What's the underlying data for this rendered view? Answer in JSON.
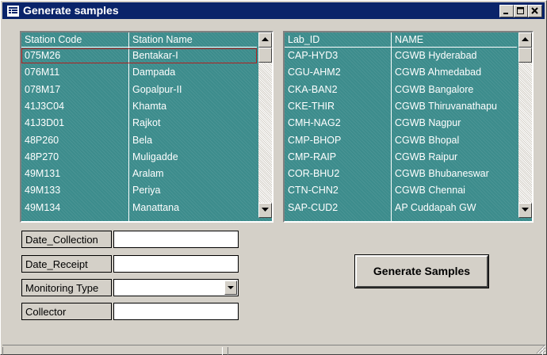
{
  "window": {
    "title": "Generate samples",
    "controls": {
      "minimize": "_",
      "maximize": "□",
      "close": "X"
    }
  },
  "stations": {
    "headers": [
      "Station Code",
      "Station Name"
    ],
    "rows": [
      [
        "075M26",
        "Bentakar-I"
      ],
      [
        "076M11",
        "Dampada"
      ],
      [
        "078M17",
        "Gopalpur-II"
      ],
      [
        "41J3C04",
        "Khamta"
      ],
      [
        "41J3D01",
        "Rajkot"
      ],
      [
        "48P260",
        "Bela"
      ],
      [
        "48P270",
        "Muligadde"
      ],
      [
        "49M131",
        "Aralam"
      ],
      [
        "49M133",
        "Periya"
      ],
      [
        "49M134",
        "Manattana"
      ]
    ]
  },
  "labs": {
    "headers": [
      "Lab_ID",
      "NAME"
    ],
    "rows": [
      [
        "CAP-HYD3",
        "CGWB  Hyderabad"
      ],
      [
        "CGU-AHM2",
        "CGWB  Ahmedabad"
      ],
      [
        "CKA-BAN2",
        "CGWB Bangalore"
      ],
      [
        "CKE-THIR",
        "CGWB Thiruvanathapu"
      ],
      [
        "CMH-NAG2",
        "CGWB Nagpur"
      ],
      [
        "CMP-BHOP",
        "CGWB Bhopal"
      ],
      [
        "CMP-RAIP",
        "CGWB Raipur"
      ],
      [
        "COR-BHU2",
        "CGWB Bhubaneswar"
      ],
      [
        "CTN-CHN2",
        "CGWB Chennai"
      ],
      [
        "SAP-CUD2",
        "AP Cuddapah GW"
      ]
    ]
  },
  "form": {
    "date_collection_label": "Date_Collection",
    "date_collection_value": "",
    "date_receipt_label": "Date_Receipt",
    "date_receipt_value": "",
    "monitoring_type_label": "Monitoring Type",
    "monitoring_type_value": "",
    "collector_label": "Collector",
    "collector_value": ""
  },
  "generate_button_label": "Generate Samples",
  "icons": {
    "app": "form-icon",
    "scroll_up": "arrow-up-icon",
    "scroll_down": "arrow-down-icon",
    "combo": "chevron-down-icon"
  },
  "colors": {
    "titlebar": "#0a246a",
    "listbox_bg": "#3c8c8c",
    "listbox_text": "#ffffff",
    "face": "#d4d0c8",
    "selection_border": "#b02020"
  }
}
